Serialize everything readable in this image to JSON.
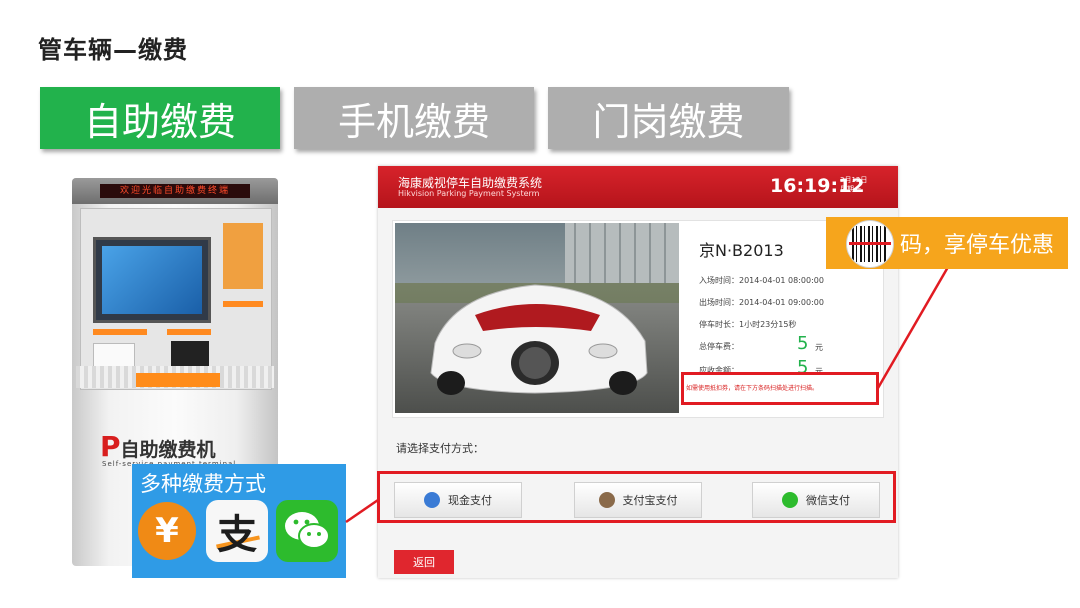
{
  "page": {
    "title": "管车辆—缴费"
  },
  "tabs": [
    {
      "label": "自助缴费",
      "active": true
    },
    {
      "label": "手机缴费",
      "active": false
    },
    {
      "label": "门岗缴费",
      "active": false
    }
  ],
  "kiosk": {
    "led_text": "欢迎光临自助缴费终端",
    "logo_mark": "P",
    "logo_text": "自助缴费机",
    "logo_sub": "Self-service payment terminal"
  },
  "methods": {
    "title": "多种缴费方式",
    "yuan_symbol": "¥",
    "alipay_glyph": "支",
    "icons": [
      "yuan-icon",
      "alipay-icon",
      "wechat-icon"
    ]
  },
  "app": {
    "title_cn": "海康威视停车自助缴费系统",
    "title_en": "Hikvision Parking Payment Systerm",
    "time": "16:19:12",
    "date": "3月12日",
    "weekday": "星期一",
    "plate": "京N·B2013",
    "rows": [
      {
        "label": "入场时间：2014-04-01  08:00:00"
      },
      {
        "label": "出场时间：2014-04-01  09:00:00"
      },
      {
        "label": "停车时长：1小时23分15秒"
      },
      {
        "label": "总停车费："
      },
      {
        "label": "应收金额："
      }
    ],
    "total_fee": "5",
    "due_fee": "5",
    "unit": "元",
    "coupon_note": "如需使用抵扣券，请在下方条码扫描处进行扫描。",
    "select_label": "请选择支付方式：",
    "pay_buttons": [
      "现金支付",
      "支付宝支付",
      "微信支付"
    ],
    "back_label": "返回"
  },
  "callout": {
    "text": "码，享停车优惠"
  },
  "colors": {
    "active_tab": "#22b24c",
    "inactive_tab": "#aeaeae",
    "header_red": "#d7232b",
    "highlight_red": "#e11b22",
    "callout_orange": "#f6a51c",
    "methods_blue": "#2f9be6"
  }
}
